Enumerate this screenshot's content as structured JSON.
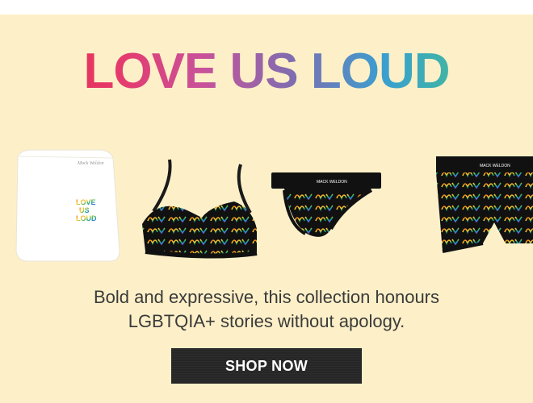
{
  "banner": {
    "headline": "LOVE US LOUD",
    "description_line1": "Bold and expressive, this collection honours",
    "description_line2": "LGBTQIA+ stories without apology.",
    "cta_label": "SHOP NOW"
  },
  "products": [
    {
      "name": "tshirt",
      "pocket_text": "LOVE US LOUD"
    },
    {
      "name": "bralette"
    },
    {
      "name": "jockstrap"
    },
    {
      "name": "boxer-brief"
    }
  ],
  "colors": {
    "background": "#fdf0c8",
    "text": "#3a3a3a",
    "button": "#262626",
    "gradient": [
      "#e02b3c",
      "#e63a6c",
      "#c8529a",
      "#7f6db0",
      "#3a9fd0",
      "#44c08c"
    ]
  }
}
